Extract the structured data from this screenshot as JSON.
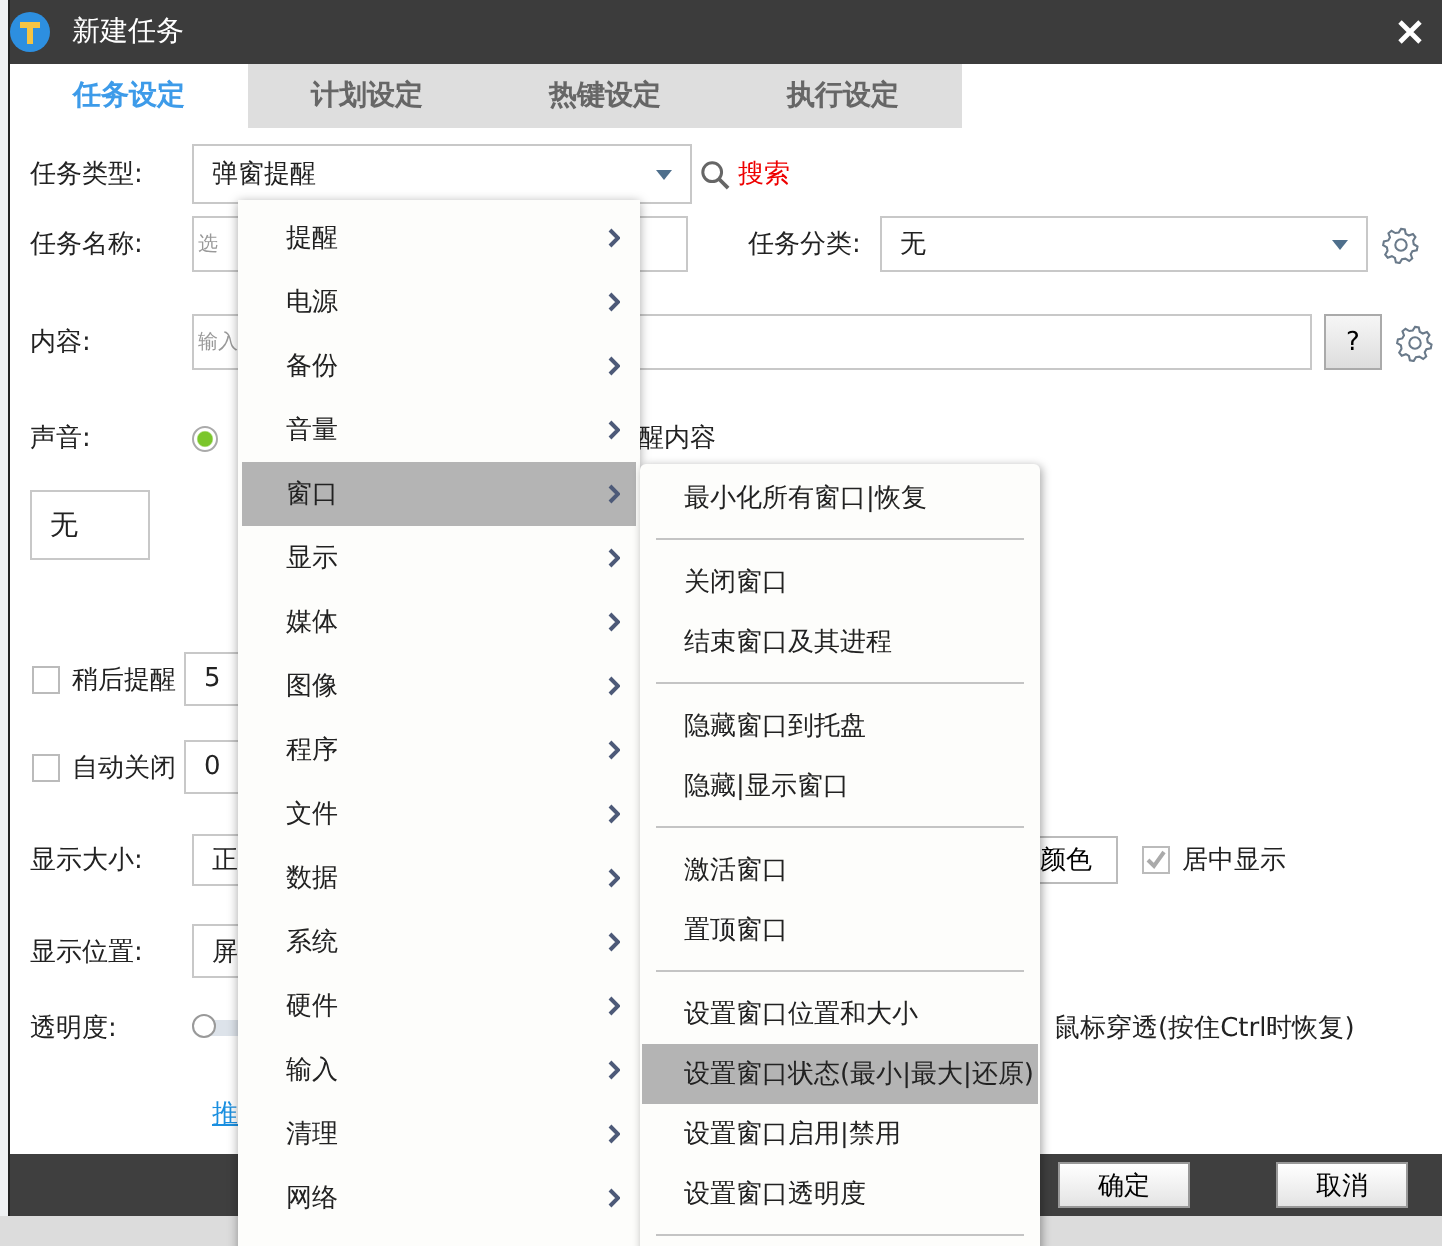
{
  "window": {
    "title": "新建任务"
  },
  "tabs": [
    {
      "label": "任务设定",
      "selected": true
    },
    {
      "label": "计划设定",
      "selected": false
    },
    {
      "label": "热键设定",
      "selected": false
    },
    {
      "label": "执行设定",
      "selected": false
    }
  ],
  "form": {
    "type_label": "任务类型:",
    "type_value": "弹窗提醒",
    "search_link": "搜索",
    "name_label": "任务名称:",
    "name_placeholder": "选",
    "category_label": "任务分类:",
    "category_value": "无",
    "content_label": "内容:",
    "content_placeholder": "输入",
    "help_button": "?",
    "sound_label": "声音:",
    "sound_radio_selected": true,
    "sound_option_text": "醒内容",
    "sound_value": "无",
    "remind_later": {
      "label": "稍后提醒",
      "checked": false,
      "value": "5"
    },
    "auto_close": {
      "label": "自动关闭",
      "checked": false,
      "value": "0"
    },
    "size_label": "显示大小:",
    "size_value": "正",
    "color_button": "颜色",
    "center": {
      "label": "居中显示",
      "checked": true
    },
    "position_label": "显示位置:",
    "position_value": "屏",
    "opacity_label": "透明度:",
    "opacity": {
      "level": 0
    },
    "mouse_through": "鼠标穿透(按住Ctrl时恢复)",
    "link": "推"
  },
  "footer": {
    "buttons": [
      "确定",
      "取消"
    ]
  },
  "type_menu": [
    {
      "label": "提醒",
      "selected": false
    },
    {
      "label": "电源",
      "selected": false
    },
    {
      "label": "备份",
      "selected": false
    },
    {
      "label": "音量",
      "selected": false
    },
    {
      "label": "窗口",
      "selected": true
    },
    {
      "label": "显示",
      "selected": false
    },
    {
      "label": "媒体",
      "selected": false
    },
    {
      "label": "图像",
      "selected": false
    },
    {
      "label": "程序",
      "selected": false
    },
    {
      "label": "文件",
      "selected": false
    },
    {
      "label": "数据",
      "selected": false
    },
    {
      "label": "系统",
      "selected": false
    },
    {
      "label": "硬件",
      "selected": false
    },
    {
      "label": "输入",
      "selected": false
    },
    {
      "label": "清理",
      "selected": false
    },
    {
      "label": "网络",
      "selected": false
    }
  ],
  "window_submenu": [
    [
      {
        "label": "最小化所有窗口|恢复",
        "selected": false
      }
    ],
    [
      {
        "label": "关闭窗口",
        "selected": false
      },
      {
        "label": "结束窗口及其进程",
        "selected": false
      }
    ],
    [
      {
        "label": "隐藏窗口到托盘",
        "selected": false
      },
      {
        "label": "隐藏|显示窗口",
        "selected": false
      }
    ],
    [
      {
        "label": "激活窗口",
        "selected": false
      },
      {
        "label": "置顶窗口",
        "selected": false
      }
    ],
    [
      {
        "label": "设置窗口位置和大小",
        "selected": false
      },
      {
        "label": "设置窗口状态(最小|最大|还原)",
        "selected": true
      },
      {
        "label": "设置窗口启用|禁用",
        "selected": false
      },
      {
        "label": "设置窗口透明度",
        "selected": false
      }
    ]
  ]
}
